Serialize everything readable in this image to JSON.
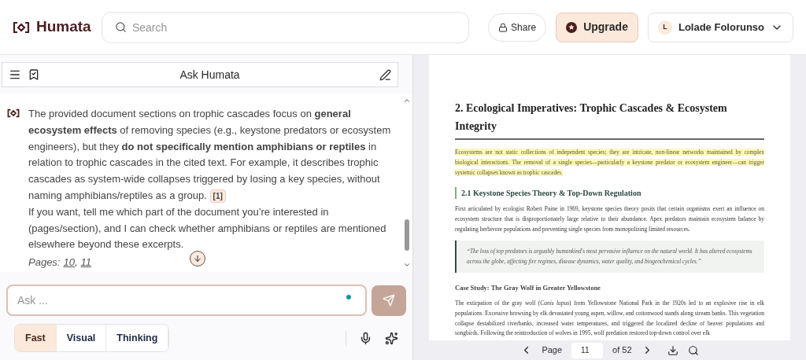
{
  "header": {
    "logo": "Humata",
    "search": {
      "placeholder": "Search"
    },
    "share": "Share",
    "upgrade": "Upgrade",
    "user": {
      "initial": "L",
      "name": "Lolade Folorunso"
    }
  },
  "chat": {
    "title": "Ask Humata",
    "message": {
      "paragraphs": [
        "The provided document sections on trophic cascades focus on **general ecosystem effects** of removing species (e.g., keystone predators or ecosystem engineers), but they **do not specifically mention amphibians or reptiles** in relation to trophic cascades in the cited text. For example, it describes trophic cascades as system-wide collapses triggered by losing a key species, without naming amphibians/reptiles as a group.",
        "If you want, tell me which part of the document you’re interested in (pages/section), and I can check whether amphibians or reptiles are mentioned elsewhere beyond these excerpts."
      ],
      "citation": "[1]",
      "pages_label": "Pages:",
      "pages": [
        "10",
        "11"
      ],
      "pages_separator": ","
    },
    "input": {
      "placeholder": "Ask ..."
    },
    "modes": [
      {
        "label": "Fast",
        "selected": true
      },
      {
        "label": "Visual",
        "selected": false
      },
      {
        "label": "Thinking",
        "selected": false
      }
    ]
  },
  "document": {
    "heading": "2. Ecological Imperatives: Trophic Cascades & Ecosystem Integrity",
    "highlight": "Ecosystems are not static collections of independent species; they are intricate, non-linear networks maintained by complex biological interactions. The removal of a single species—particularly a keystone predator or ecosystem engineer—can trigger systemic collapses known as trophic cascades.",
    "subheading": "2.1 Keystone Species Theory & Top-Down Regulation",
    "paragraph": "First articulated by ecologist Robert Paine in 1969, keystone species theory posits that certain organisms exert an influence on ecosystem structure that is disproportionately large relative to their abundance. Apex predators maintain ecosystem balance by regulating herbivore populations and preventing single species from monopolizing limited resources.",
    "quote": "“The loss of top predators is arguably humankind's most pervasive influence on the natural world. It has altered ecosystems across the globe, affecting fire regimes, disease dynamics, water quality, and biogeochemical cycles.”",
    "case_title": "Case Study: The Gray Wolf in Greater Yellowstone",
    "case_text": "The extirpation of the gray wolf (*Canis lupus*) from Yellowstone National Park in the 1920s led to an explosive rise in elk populations. Excessive browsing by elk devastated young aspen, willow, and cottonwood stands along stream banks. This vegetation collapse destabilized riverbanks, increased water temperatures, and triggered the localized decline of beaver populations and songbirds. Following the reintroduction of wolves in 1995, wolf predation restored top-down control over elk"
  },
  "pager": {
    "label": "Page",
    "page": "11",
    "total": "of 52"
  }
}
